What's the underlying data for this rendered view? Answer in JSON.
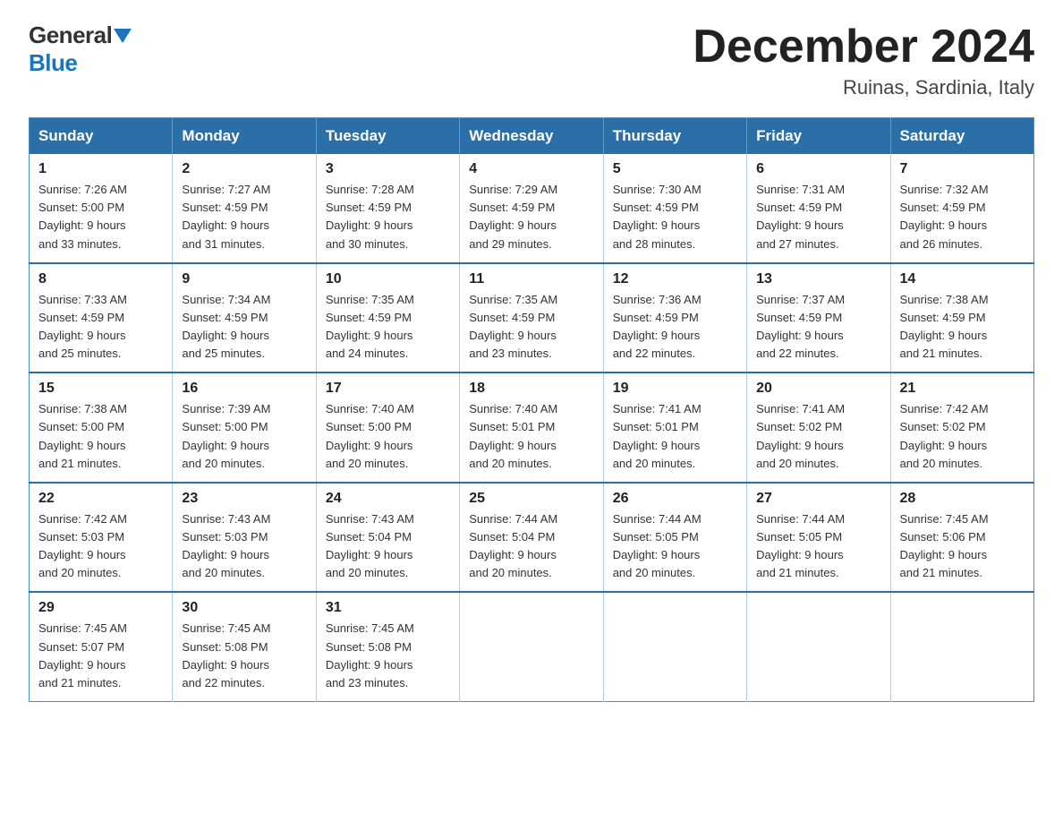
{
  "logo": {
    "general": "General",
    "blue": "Blue"
  },
  "title": "December 2024",
  "subtitle": "Ruinas, Sardinia, Italy",
  "weekdays": [
    "Sunday",
    "Monday",
    "Tuesday",
    "Wednesday",
    "Thursday",
    "Friday",
    "Saturday"
  ],
  "weeks": [
    [
      {
        "day": "1",
        "info": "Sunrise: 7:26 AM\nSunset: 5:00 PM\nDaylight: 9 hours\nand 33 minutes."
      },
      {
        "day": "2",
        "info": "Sunrise: 7:27 AM\nSunset: 4:59 PM\nDaylight: 9 hours\nand 31 minutes."
      },
      {
        "day": "3",
        "info": "Sunrise: 7:28 AM\nSunset: 4:59 PM\nDaylight: 9 hours\nand 30 minutes."
      },
      {
        "day": "4",
        "info": "Sunrise: 7:29 AM\nSunset: 4:59 PM\nDaylight: 9 hours\nand 29 minutes."
      },
      {
        "day": "5",
        "info": "Sunrise: 7:30 AM\nSunset: 4:59 PM\nDaylight: 9 hours\nand 28 minutes."
      },
      {
        "day": "6",
        "info": "Sunrise: 7:31 AM\nSunset: 4:59 PM\nDaylight: 9 hours\nand 27 minutes."
      },
      {
        "day": "7",
        "info": "Sunrise: 7:32 AM\nSunset: 4:59 PM\nDaylight: 9 hours\nand 26 minutes."
      }
    ],
    [
      {
        "day": "8",
        "info": "Sunrise: 7:33 AM\nSunset: 4:59 PM\nDaylight: 9 hours\nand 25 minutes."
      },
      {
        "day": "9",
        "info": "Sunrise: 7:34 AM\nSunset: 4:59 PM\nDaylight: 9 hours\nand 25 minutes."
      },
      {
        "day": "10",
        "info": "Sunrise: 7:35 AM\nSunset: 4:59 PM\nDaylight: 9 hours\nand 24 minutes."
      },
      {
        "day": "11",
        "info": "Sunrise: 7:35 AM\nSunset: 4:59 PM\nDaylight: 9 hours\nand 23 minutes."
      },
      {
        "day": "12",
        "info": "Sunrise: 7:36 AM\nSunset: 4:59 PM\nDaylight: 9 hours\nand 22 minutes."
      },
      {
        "day": "13",
        "info": "Sunrise: 7:37 AM\nSunset: 4:59 PM\nDaylight: 9 hours\nand 22 minutes."
      },
      {
        "day": "14",
        "info": "Sunrise: 7:38 AM\nSunset: 4:59 PM\nDaylight: 9 hours\nand 21 minutes."
      }
    ],
    [
      {
        "day": "15",
        "info": "Sunrise: 7:38 AM\nSunset: 5:00 PM\nDaylight: 9 hours\nand 21 minutes."
      },
      {
        "day": "16",
        "info": "Sunrise: 7:39 AM\nSunset: 5:00 PM\nDaylight: 9 hours\nand 20 minutes."
      },
      {
        "day": "17",
        "info": "Sunrise: 7:40 AM\nSunset: 5:00 PM\nDaylight: 9 hours\nand 20 minutes."
      },
      {
        "day": "18",
        "info": "Sunrise: 7:40 AM\nSunset: 5:01 PM\nDaylight: 9 hours\nand 20 minutes."
      },
      {
        "day": "19",
        "info": "Sunrise: 7:41 AM\nSunset: 5:01 PM\nDaylight: 9 hours\nand 20 minutes."
      },
      {
        "day": "20",
        "info": "Sunrise: 7:41 AM\nSunset: 5:02 PM\nDaylight: 9 hours\nand 20 minutes."
      },
      {
        "day": "21",
        "info": "Sunrise: 7:42 AM\nSunset: 5:02 PM\nDaylight: 9 hours\nand 20 minutes."
      }
    ],
    [
      {
        "day": "22",
        "info": "Sunrise: 7:42 AM\nSunset: 5:03 PM\nDaylight: 9 hours\nand 20 minutes."
      },
      {
        "day": "23",
        "info": "Sunrise: 7:43 AM\nSunset: 5:03 PM\nDaylight: 9 hours\nand 20 minutes."
      },
      {
        "day": "24",
        "info": "Sunrise: 7:43 AM\nSunset: 5:04 PM\nDaylight: 9 hours\nand 20 minutes."
      },
      {
        "day": "25",
        "info": "Sunrise: 7:44 AM\nSunset: 5:04 PM\nDaylight: 9 hours\nand 20 minutes."
      },
      {
        "day": "26",
        "info": "Sunrise: 7:44 AM\nSunset: 5:05 PM\nDaylight: 9 hours\nand 20 minutes."
      },
      {
        "day": "27",
        "info": "Sunrise: 7:44 AM\nSunset: 5:05 PM\nDaylight: 9 hours\nand 21 minutes."
      },
      {
        "day": "28",
        "info": "Sunrise: 7:45 AM\nSunset: 5:06 PM\nDaylight: 9 hours\nand 21 minutes."
      }
    ],
    [
      {
        "day": "29",
        "info": "Sunrise: 7:45 AM\nSunset: 5:07 PM\nDaylight: 9 hours\nand 21 minutes."
      },
      {
        "day": "30",
        "info": "Sunrise: 7:45 AM\nSunset: 5:08 PM\nDaylight: 9 hours\nand 22 minutes."
      },
      {
        "day": "31",
        "info": "Sunrise: 7:45 AM\nSunset: 5:08 PM\nDaylight: 9 hours\nand 23 minutes."
      },
      {
        "day": "",
        "info": ""
      },
      {
        "day": "",
        "info": ""
      },
      {
        "day": "",
        "info": ""
      },
      {
        "day": "",
        "info": ""
      }
    ]
  ]
}
